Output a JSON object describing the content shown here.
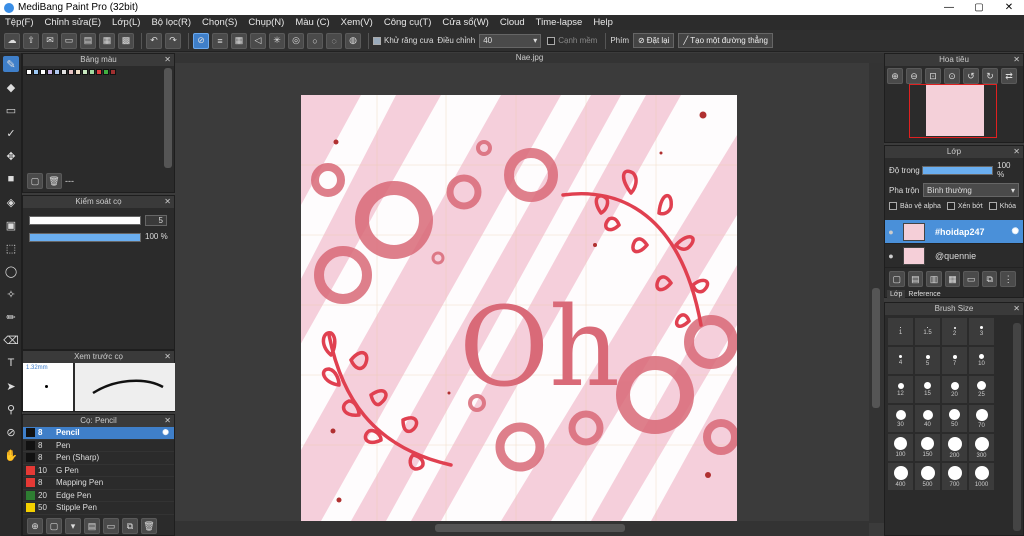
{
  "app": {
    "title": "MediBang Paint Pro (32bit)"
  },
  "window_buttons": [
    "—",
    "▢",
    "✕"
  ],
  "menu": [
    "Tệp(F)",
    "Chỉnh sửa(E)",
    "Lớp(L)",
    "Bộ lọc(R)",
    "Chọn(S)",
    "Chụp(N)",
    "Màu (C)",
    "Xem(V)",
    "Công cụ(T)",
    "Cửa sổ(W)",
    "Cloud",
    "Time-lapse",
    "Help"
  ],
  "toolbar": {
    "antialias_label": "Khử răng cưa",
    "adjust_label": "Điều chỉnh",
    "adjust_value": "40",
    "smooth_edge_label": "Cạnh mềm",
    "key_label": "Phím",
    "reset_label": "Đặt lại",
    "create_straight_label": "Tạo một đường thẳng"
  },
  "document": {
    "tab": "Nae.jpg"
  },
  "panels": {
    "palette": {
      "title": "Bảng màu",
      "footer": "---"
    },
    "brush_control": {
      "title": "Kiểm soát cọ",
      "size_value": "5",
      "opacity_value": "100 %"
    },
    "brush_preview": {
      "title": "Xem trước cọ",
      "size": "1.32mm"
    },
    "brush_list": {
      "title": "Cọ: Pencil",
      "items": [
        {
          "size": "8",
          "name": "Pencil",
          "color": "#111111"
        },
        {
          "size": "8",
          "name": "Pen",
          "color": "#111111"
        },
        {
          "size": "8",
          "name": "Pen (Sharp)",
          "color": "#111111"
        },
        {
          "size": "10",
          "name": "G Pen",
          "color": "#e53935"
        },
        {
          "size": "8",
          "name": "Mapping Pen",
          "color": "#e53935"
        },
        {
          "size": "20",
          "name": "Edge Pen",
          "color": "#2e7d32"
        },
        {
          "size": "50",
          "name": "Stipple Pen",
          "color": "#f4d000"
        }
      ]
    },
    "navigator": {
      "title": "Hoa tiêu"
    },
    "layers": {
      "title": "Lớp",
      "opacity_label": "Độ trong",
      "opacity_value": "100 %",
      "blend_label": "Pha trộn",
      "blend_value": "Bình thường",
      "protect_alpha": "Bảo vệ alpha",
      "clip": "Xén bớt",
      "lock": "Khóa",
      "items": [
        {
          "name": "#hoidap247"
        },
        {
          "name": "@quennie"
        }
      ],
      "tabs": [
        "Lớp",
        "Reference"
      ]
    },
    "brush_size": {
      "title": "Brush Size",
      "sizes": [
        "1",
        "1.5",
        "2",
        "3",
        "4",
        "5",
        "7",
        "10",
        "12",
        "15",
        "20",
        "25",
        "30",
        "40",
        "50",
        "70",
        "100",
        "150",
        "200",
        "300",
        "400",
        "500",
        "700",
        "1000"
      ]
    }
  },
  "artwork": {
    "text": "Oh"
  }
}
